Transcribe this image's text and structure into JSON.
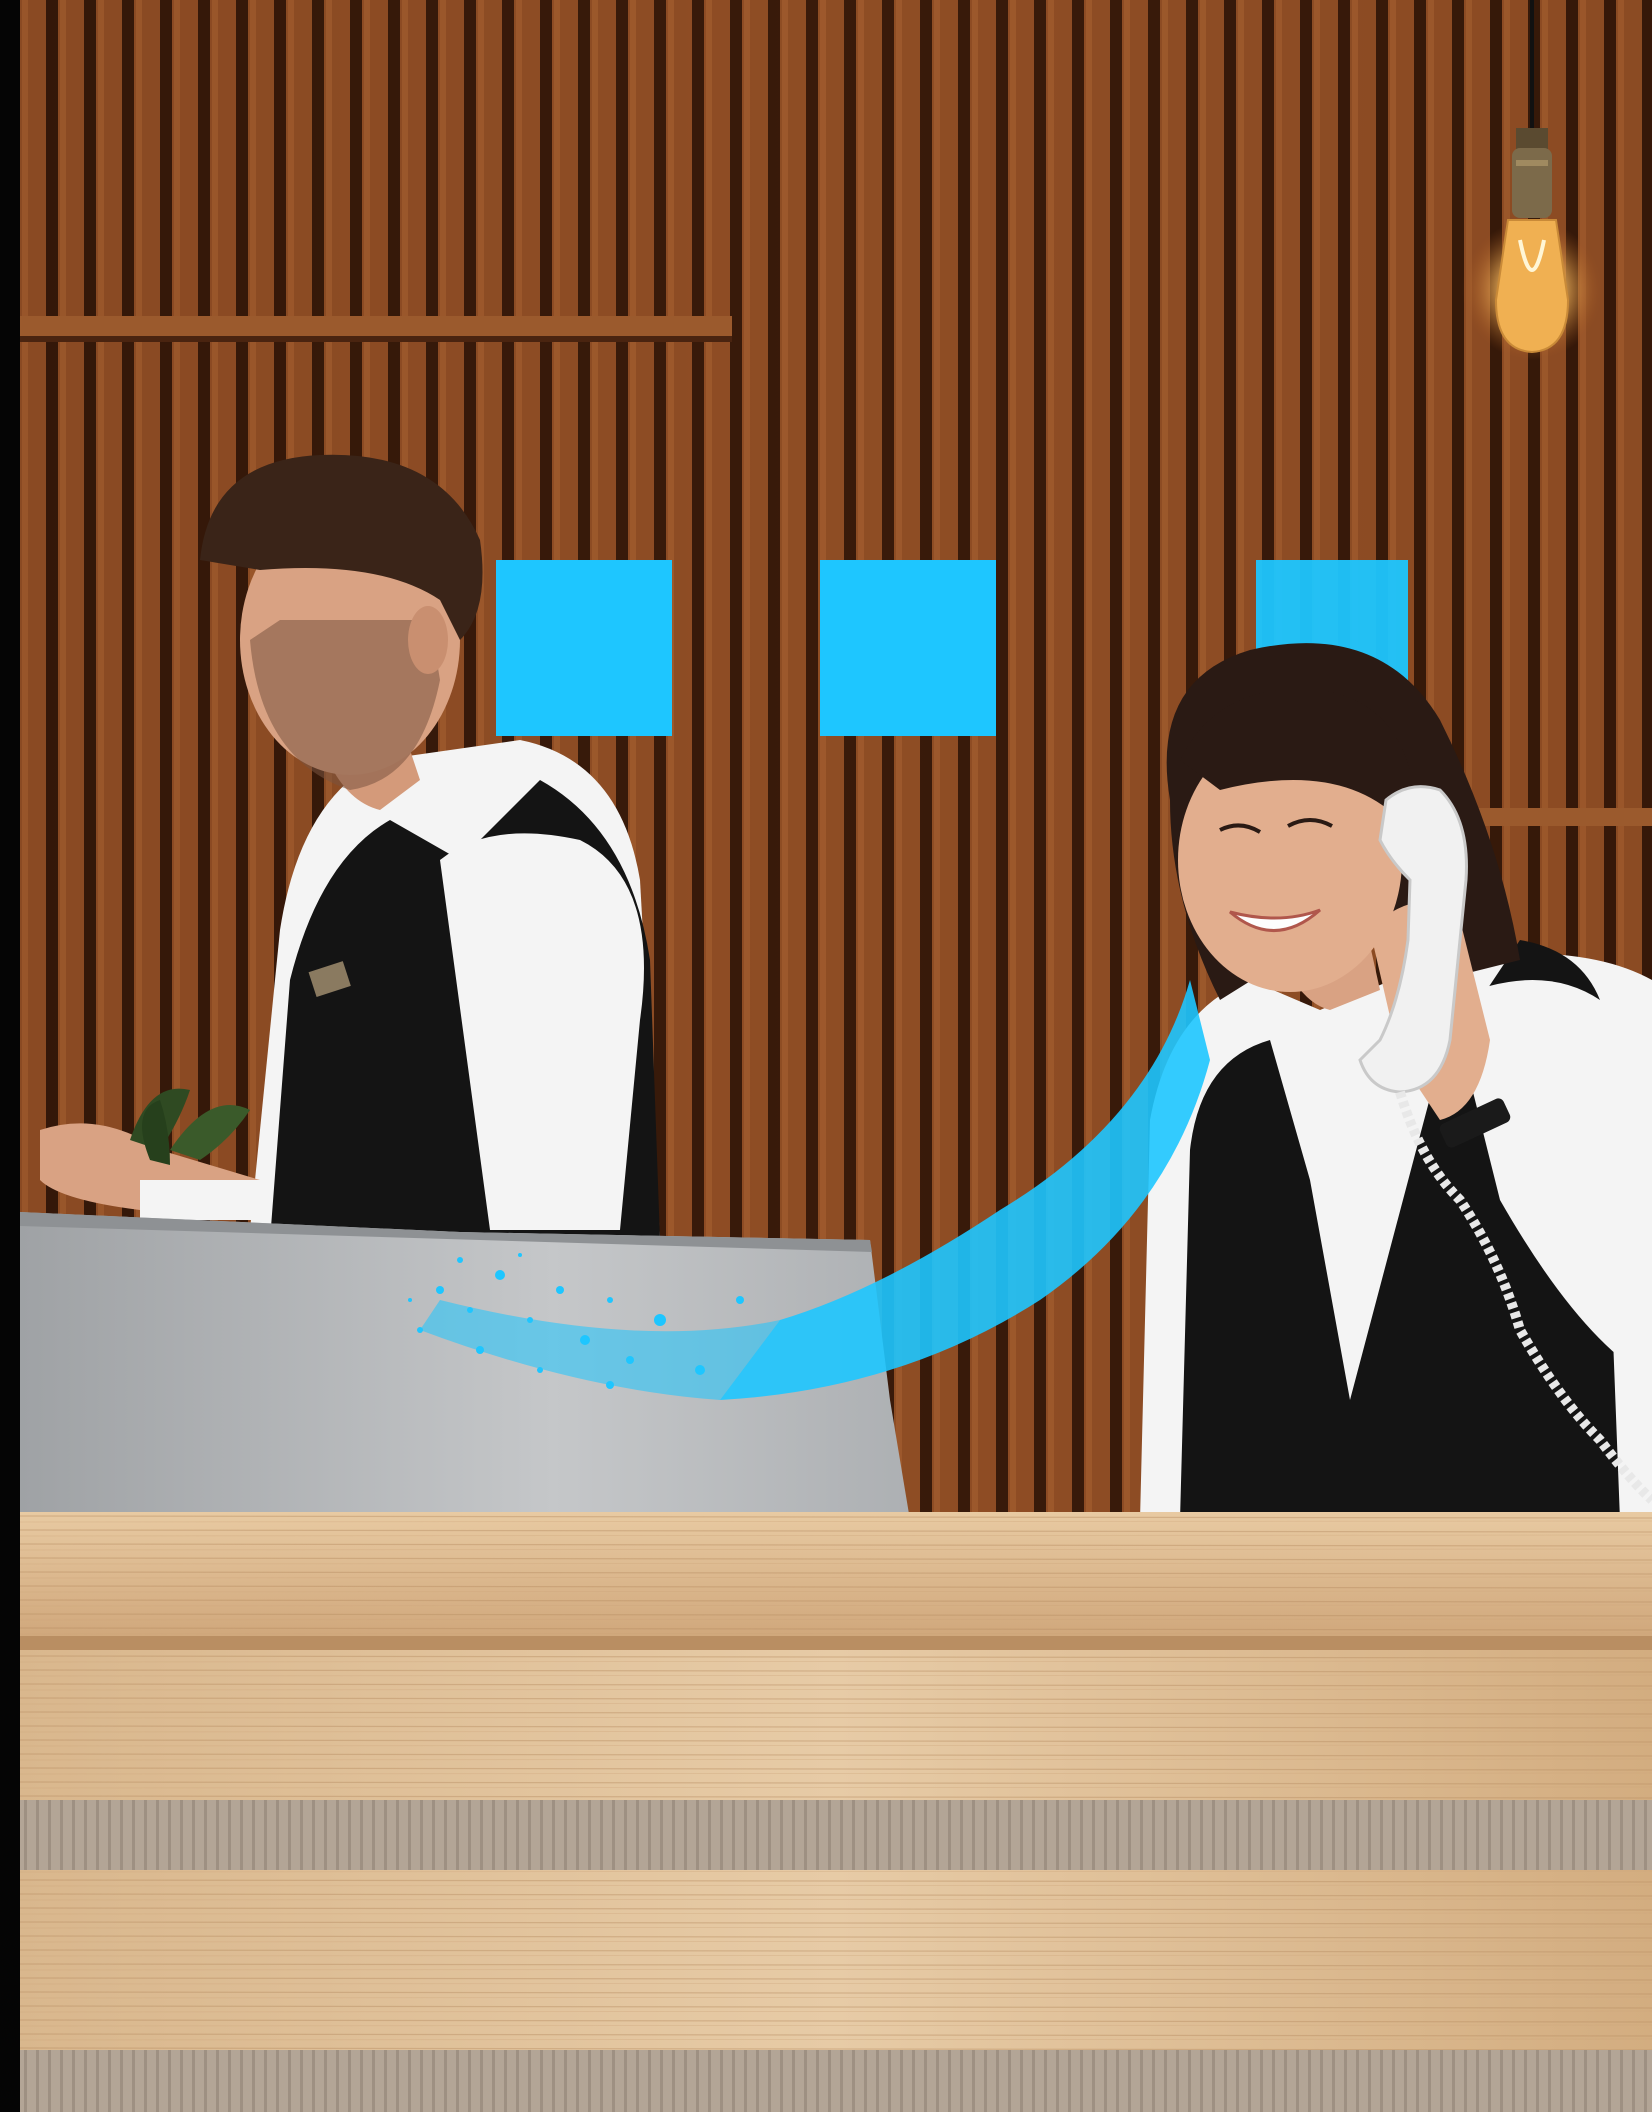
{
  "scene": {
    "subject": "hotel-reception",
    "colors": {
      "wood_wall": "#8a4a22",
      "wood_slat_dark": "#3a1a0a",
      "desk": "#dcb98f",
      "accent": "#1ec6ff",
      "vest": "#141414",
      "shirt": "#f4f4f4",
      "monitor": "#b9bcbf"
    },
    "icons": [
      "pendant-lamp-icon",
      "phone-handset-icon"
    ]
  }
}
